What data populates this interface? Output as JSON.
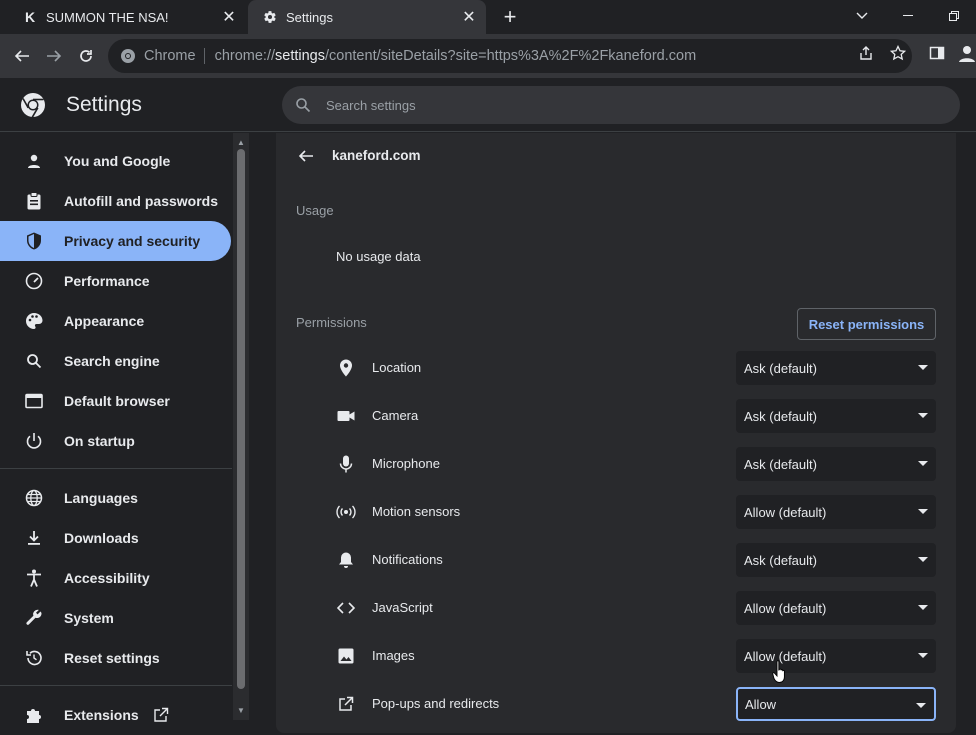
{
  "tabs": [
    {
      "title": "SUMMON THE NSA!",
      "favicon": "K",
      "active": false
    },
    {
      "title": "Settings",
      "favicon": "gear",
      "active": true
    }
  ],
  "omnibox": {
    "chip": "Chrome",
    "url_prefix": "chrome://",
    "url_host": "settings",
    "url_path": "/content/siteDetails?site=https%3A%2F%2Fkaneford.com"
  },
  "header": {
    "title": "Settings",
    "search_placeholder": "Search settings"
  },
  "sidebar": {
    "items": [
      {
        "label": "You and Google",
        "icon": "person-icon"
      },
      {
        "label": "Autofill and passwords",
        "icon": "clipboard-icon"
      },
      {
        "label": "Privacy and security",
        "icon": "shield-icon",
        "active": true
      },
      {
        "label": "Performance",
        "icon": "speedometer-icon"
      },
      {
        "label": "Appearance",
        "icon": "palette-icon"
      },
      {
        "label": "Search engine",
        "icon": "search-icon"
      },
      {
        "label": "Default browser",
        "icon": "browser-icon"
      },
      {
        "label": "On startup",
        "icon": "power-icon"
      },
      {
        "label": "Languages",
        "icon": "globe-icon"
      },
      {
        "label": "Downloads",
        "icon": "download-icon"
      },
      {
        "label": "Accessibility",
        "icon": "accessibility-icon"
      },
      {
        "label": "System",
        "icon": "wrench-icon"
      },
      {
        "label": "Reset settings",
        "icon": "reset-icon"
      },
      {
        "label": "Extensions",
        "icon": "puzzle-icon"
      }
    ]
  },
  "site": {
    "title": "kaneford.com",
    "usage_label": "Usage",
    "usage_text": "No usage data",
    "permissions_label": "Permissions",
    "reset_button": "Reset permissions"
  },
  "permissions": [
    {
      "label": "Location",
      "value": "Ask (default)",
      "icon": "location-pin-icon"
    },
    {
      "label": "Camera",
      "value": "Ask (default)",
      "icon": "camera-icon"
    },
    {
      "label": "Microphone",
      "value": "Ask (default)",
      "icon": "microphone-icon"
    },
    {
      "label": "Motion sensors",
      "value": "Allow (default)",
      "icon": "motion-sensor-icon"
    },
    {
      "label": "Notifications",
      "value": "Ask (default)",
      "icon": "bell-icon"
    },
    {
      "label": "JavaScript",
      "value": "Allow (default)",
      "icon": "code-icon"
    },
    {
      "label": "Images",
      "value": "Allow (default)",
      "icon": "image-icon"
    },
    {
      "label": "Pop-ups and redirects",
      "value": "Allow",
      "icon": "open-external-icon"
    }
  ],
  "colors": {
    "accent": "#8ab4f8",
    "background": "#202124",
    "card": "#292a2d"
  }
}
